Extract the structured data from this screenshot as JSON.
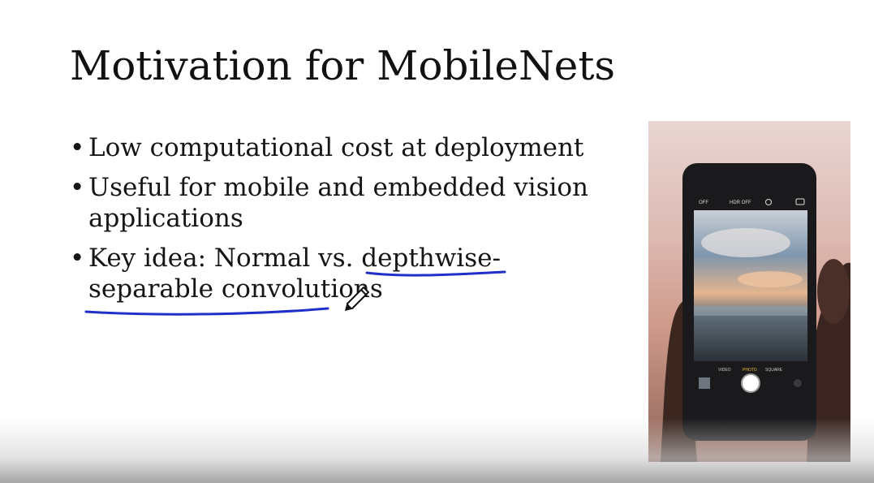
{
  "slide": {
    "title": "Motivation for MobileNets",
    "bullets": [
      {
        "lines": [
          "Low computational cost at deployment"
        ]
      },
      {
        "lines": [
          "Useful for mobile and embedded vision",
          "applications"
        ]
      },
      {
        "lines": [
          "Key idea: Normal vs. depthwise-",
          "separable convolutions"
        ]
      }
    ],
    "bullet_symbol": "•"
  },
  "annotations": {
    "underline_color": "#1f2fc7",
    "tool_icon": "pen-icon"
  },
  "photo": {
    "camera_modes": [
      "VIDEO",
      "PHOTO",
      "SQUARE"
    ],
    "flash_label": "OFF",
    "hdr_label": "HDR OFF"
  }
}
